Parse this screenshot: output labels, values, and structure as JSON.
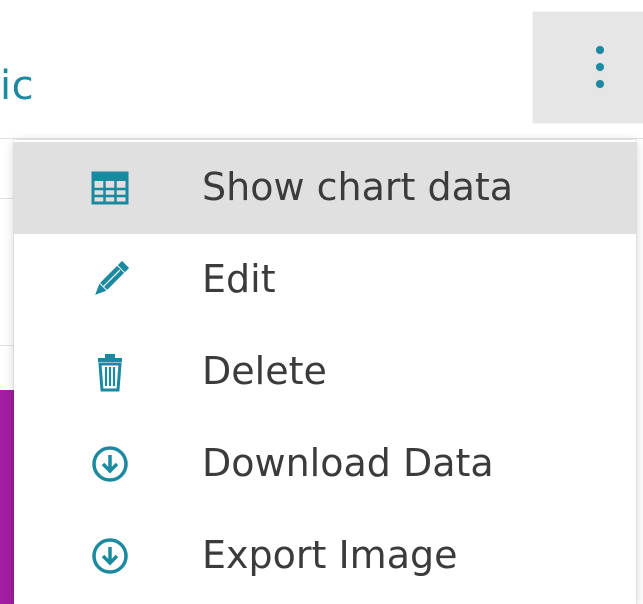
{
  "background": {
    "title_fragment": "ic"
  },
  "toolbar": {
    "more_button_icon": "kebab-vertical-icon"
  },
  "menu": {
    "items": [
      {
        "label": "Show chart data",
        "icon": "table-icon",
        "active": true
      },
      {
        "label": "Edit",
        "icon": "pencil-icon",
        "active": false
      },
      {
        "label": "Delete",
        "icon": "trash-icon",
        "active": false
      },
      {
        "label": "Download Data",
        "icon": "download-circle-icon",
        "active": false
      },
      {
        "label": "Export Image",
        "icon": "download-circle-icon",
        "active": false
      }
    ]
  },
  "colors": {
    "accent": "#1b8aa0",
    "active_bg": "#e0e0e0",
    "text": "#3b3b3b",
    "purple": "#a21fa3"
  }
}
